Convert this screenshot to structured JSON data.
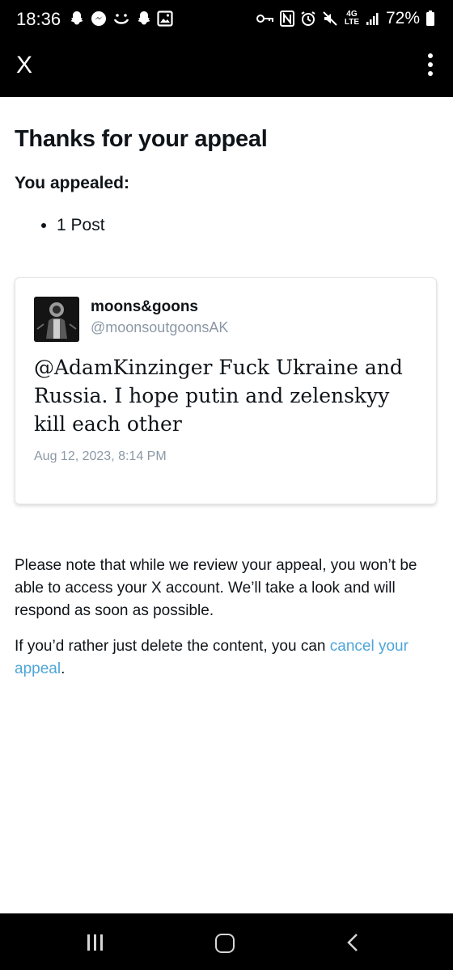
{
  "status_bar": {
    "time": "18:36",
    "battery": "72%",
    "left_icons": [
      "snapchat-icon",
      "messenger-icon",
      "smiley-icon",
      "snapchat-icon",
      "gallery-icon"
    ],
    "right_icons": [
      "key-icon",
      "nfc-icon",
      "alarm-icon",
      "mute-icon",
      "4g-lte-icon",
      "signal-icon",
      "battery-icon"
    ],
    "network": "4G LTE"
  },
  "app_bar": {
    "close_label": "X"
  },
  "page": {
    "title": "Thanks for your appeal",
    "subtitle": "You appealed:",
    "appealed_items": [
      "1 Post"
    ]
  },
  "post": {
    "display_name": "moons&goons",
    "handle": "@moonsoutgoonsAK",
    "text": "@AdamKinzinger Fuck Ukraine and Russia. I hope putin and zelenskyy kill each other",
    "date": "Aug 12, 2023, 8:14 PM"
  },
  "note": {
    "review_text": "Please note that while we review your appeal, you won’t be able to access your X account. We’ll take a look and will respond as soon as possible.",
    "delete_prefix": "If you’d rather just delete the content, you can ",
    "cancel_link": "cancel your appeal",
    "delete_suffix": "."
  },
  "colors": {
    "link": "#4ea5d9",
    "secondary_text": "#8b98a5",
    "bar_background": "#000000"
  }
}
